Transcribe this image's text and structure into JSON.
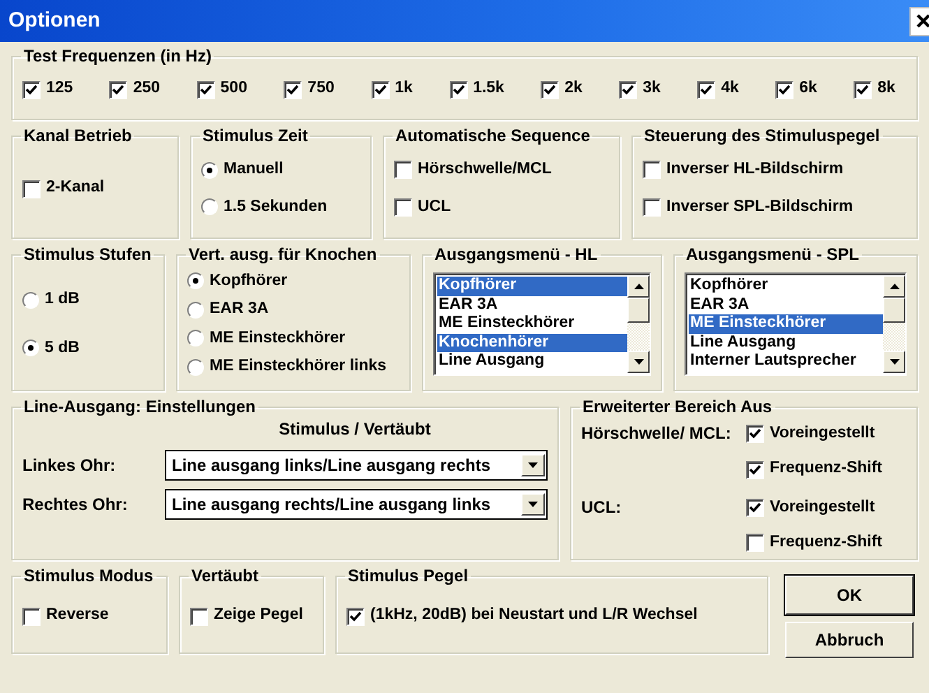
{
  "window": {
    "title": "Optionen"
  },
  "rows": [
    [
      {
        "title": "Test Frequenzen (in Hz)",
        "items": [
          {
            "kind": "checkbox",
            "label": "125",
            "checked": true
          },
          {
            "kind": "checkbox",
            "label": "250",
            "checked": true
          },
          {
            "kind": "checkbox",
            "label": "500",
            "checked": true
          },
          {
            "kind": "checkbox",
            "label": "750",
            "checked": true
          },
          {
            "kind": "checkbox",
            "label": "1k",
            "checked": true
          },
          {
            "kind": "checkbox",
            "label": "1.5k",
            "checked": true
          },
          {
            "kind": "checkbox",
            "label": "2k",
            "checked": true
          },
          {
            "kind": "checkbox",
            "label": "3k",
            "checked": true
          },
          {
            "kind": "checkbox",
            "label": "4k",
            "checked": true
          },
          {
            "kind": "checkbox",
            "label": "6k",
            "checked": true
          },
          {
            "kind": "checkbox",
            "label": "8k",
            "checked": true
          }
        ]
      }
    ],
    [
      {
        "title": "Kanal Betrieb",
        "items": [
          {
            "kind": "checkbox",
            "label": "2-Kanal",
            "checked": false
          }
        ]
      },
      {
        "title": "Stimulus Zeit",
        "items": [
          {
            "kind": "radio",
            "label": "Manuell",
            "selected": true
          },
          {
            "kind": "radio",
            "label": "1.5 Sekunden",
            "selected": false
          }
        ]
      },
      {
        "title": "Automatische Sequence",
        "items": [
          {
            "kind": "checkbox",
            "label": "Hörschwelle/MCL",
            "checked": false
          },
          {
            "kind": "checkbox",
            "label": "UCL",
            "checked": false
          }
        ]
      },
      {
        "title": "Steuerung des Stimuluspegel",
        "items": [
          {
            "kind": "checkbox",
            "label": "Inverser HL-Bildschirm",
            "checked": false
          },
          {
            "kind": "checkbox",
            "label": "Inverser SPL-Bildschirm",
            "checked": false
          }
        ]
      }
    ],
    [
      {
        "title": "Stimulus Stufen",
        "items": [
          {
            "kind": "radio",
            "label": "1 dB",
            "selected": false
          },
          {
            "kind": "radio",
            "label": "5 dB",
            "selected": true
          }
        ]
      },
      {
        "title": "Vert. ausg. für Knochen",
        "items": [
          {
            "kind": "radio",
            "label": "Kopfhörer",
            "selected": true
          },
          {
            "kind": "radio",
            "label": "EAR 3A",
            "selected": false
          },
          {
            "kind": "radio",
            "label": "ME Einsteckhörer",
            "selected": false
          },
          {
            "kind": "radio",
            "label": "ME Einsteckhörer links",
            "selected": false
          }
        ]
      },
      {
        "title": "Ausgangsmenü - HL",
        "items": [
          {
            "kind": "listbox",
            "options": [
              {
                "label": "Kopfhörer",
                "selected": true
              },
              {
                "label": "EAR 3A",
                "selected": false
              },
              {
                "label": "ME Einsteckhörer",
                "selected": false
              },
              {
                "label": "Knochenhörer",
                "selected": true
              },
              {
                "label": "Line Ausgang",
                "selected": false
              }
            ]
          }
        ]
      },
      {
        "title": "Ausgangsmenü - SPL",
        "items": [
          {
            "kind": "listbox",
            "options": [
              {
                "label": "Kopfhörer",
                "selected": false
              },
              {
                "label": "EAR 3A",
                "selected": false
              },
              {
                "label": "ME Einsteckhörer",
                "selected": true
              },
              {
                "label": "Line Ausgang",
                "selected": false
              },
              {
                "label": "Interner Lautsprecher",
                "selected": false
              }
            ]
          }
        ]
      }
    ],
    [
      {
        "title": "Line-Ausgang: Einstellungen",
        "items": [
          {
            "kind": "heading",
            "text": "Stimulus / Vertäubt"
          },
          {
            "kind": "dropdown",
            "label": "Linkes Ohr:",
            "value": "Line ausgang links/Line ausgang rechts"
          },
          {
            "kind": "dropdown",
            "label": "Rechtes Ohr:",
            "value": "Line ausgang rechts/Line ausgang links"
          }
        ]
      },
      {
        "title": "Erweiterter Bereich Aus",
        "items": [
          {
            "kind": "subgroup",
            "label": "Hörschwelle/ MCL:",
            "items": [
              {
                "kind": "checkbox",
                "label": "Voreingestellt",
                "checked": true
              },
              {
                "kind": "checkbox",
                "label": "Frequenz-Shift",
                "checked": true
              }
            ]
          },
          {
            "kind": "subgroup",
            "label": "UCL:",
            "items": [
              {
                "kind": "checkbox",
                "label": "Voreingestellt",
                "checked": true
              },
              {
                "kind": "checkbox",
                "label": "Frequenz-Shift",
                "checked": false
              }
            ]
          }
        ]
      }
    ],
    [
      {
        "title": "Stimulus Modus",
        "items": [
          {
            "kind": "checkbox",
            "label": "Reverse",
            "checked": false
          }
        ]
      },
      {
        "title": "Vertäubt",
        "items": [
          {
            "kind": "checkbox",
            "label": "Zeige Pegel",
            "checked": false
          }
        ]
      },
      {
        "title": "Stimulus Pegel",
        "items": [
          {
            "kind": "checkbox",
            "label": "(1kHz, 20dB) bei Neustart und L/R Wechsel",
            "checked": true
          }
        ]
      }
    ]
  ],
  "buttons": [
    {
      "label": "OK",
      "default": true
    },
    {
      "label": "Abbruch",
      "default": false
    }
  ]
}
